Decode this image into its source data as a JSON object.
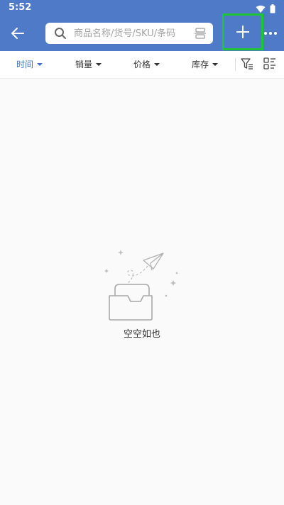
{
  "status_bar": {
    "time": "5:52"
  },
  "search": {
    "placeholder": "商品名称/货号/SKU/条码"
  },
  "sort_bar": {
    "items": [
      {
        "label": "时间",
        "active": true
      },
      {
        "label": "销量",
        "active": false
      },
      {
        "label": "价格",
        "active": false
      },
      {
        "label": "库存",
        "active": false
      }
    ]
  },
  "empty_state": {
    "text": "空空如也"
  },
  "colors": {
    "appbar": "#4f7ac7",
    "active_sort": "#3f72c3",
    "highlight_box": "#1fc633",
    "background": "#fafafa"
  },
  "icons": {
    "status": [
      "wifi-icon",
      "battery-icon"
    ],
    "toolbar": [
      "back-arrow-icon",
      "search-icon",
      "scan-icon",
      "plus-icon",
      "more-icon"
    ],
    "sort_bar": [
      "filter-icon",
      "layout-icon"
    ],
    "empty": [
      "empty-inbox-icon",
      "paper-plane-icon"
    ]
  }
}
